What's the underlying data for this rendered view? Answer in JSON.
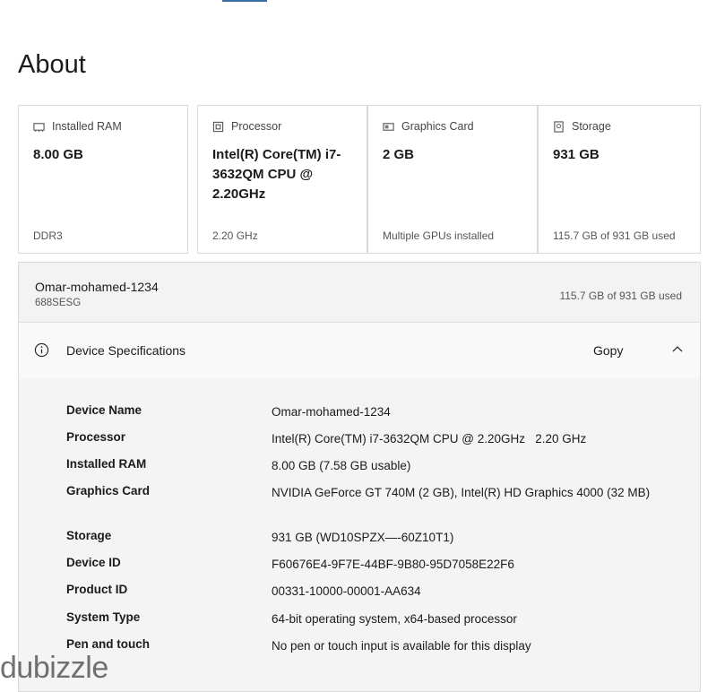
{
  "page_title": "About",
  "cards": [
    {
      "label": "Installed RAM",
      "icon": "ram-icon",
      "value": "8.00 GB",
      "foot": "DDR3"
    },
    {
      "label": "Processor",
      "icon": "processor-icon",
      "value": "Intel(R) Core(TM) i7-3632QM CPU @ 2.20GHz",
      "foot": "2.20 GHz"
    },
    {
      "label": "Graphics Card",
      "icon": "graphics-card-icon",
      "value": "2 GB",
      "foot": "Multiple GPUs installed"
    },
    {
      "label": "Storage",
      "icon": "storage-icon",
      "value": "931 GB",
      "foot": "115.7 GB of 931 GB used"
    }
  ],
  "device": {
    "name": "Omar-mohamed-1234",
    "sub": "688SESG",
    "storage": "115.7 GB of 931 GB used"
  },
  "specs": {
    "title": "Device Specifications",
    "copy_label": "Gopy",
    "rows": [
      {
        "key": "Device Name",
        "value": "Omar-mohamed-1234"
      },
      {
        "key": "Processor",
        "value": "Intel(R) Core(TM) i7-3632QM CPU @ 2.20GHz   2.20 GHz"
      },
      {
        "key": "Installed RAM",
        "value": "8.00 GB (7.58 GB usable)"
      },
      {
        "key": "Graphics Card",
        "value": "NVIDIA GeForce GT 740M (2 GB), Intel(R) HD Graphics 4000 (32 MB)"
      },
      {
        "key": "Storage",
        "value": "931 GB (WD10SPZX—-60Z10T1)"
      },
      {
        "key": "Device ID",
        "value": "F60676E4-9F7E-44BF-9B80-95D7058E22F6"
      },
      {
        "key": "Product ID",
        "value": "00331-10000-00001-AA634"
      },
      {
        "key": "System Type",
        "value": "64-bit operating system, x64-based processor"
      },
      {
        "key": "Pen and touch",
        "value": "No pen or touch input is available for this display"
      }
    ]
  },
  "watermark": "dubizzle"
}
